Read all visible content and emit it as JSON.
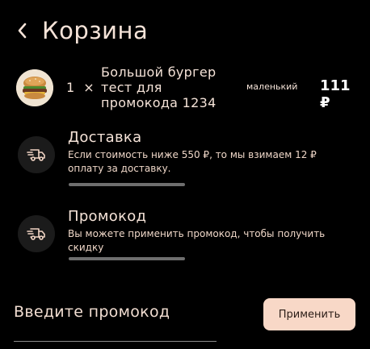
{
  "header": {
    "title": "Корзина"
  },
  "cart_item": {
    "quantity": "1",
    "times": "×",
    "name": "Большой бургер тест для промокода 1234",
    "size": "маленький",
    "price": "111 ₽"
  },
  "delivery": {
    "title": "Доставка",
    "description": "Если стоимость ниже 550 ₽, то мы взимаем 12 ₽ оплату за доставку."
  },
  "promo_info": {
    "title": "Промокод",
    "description": "Вы можете применить промокод, чтобы получить скидку"
  },
  "promo_form": {
    "placeholder": "Введите промокод",
    "apply_label": "Применить"
  },
  "colors": {
    "background": "#000000",
    "text": "#f5e3d8",
    "button": "#f8d8c7",
    "icon_bg": "#1b1b1b"
  },
  "icons": {
    "back": "chevron-left-icon",
    "delivery": "delivery-truck-icon",
    "promo": "delivery-truck-icon"
  }
}
